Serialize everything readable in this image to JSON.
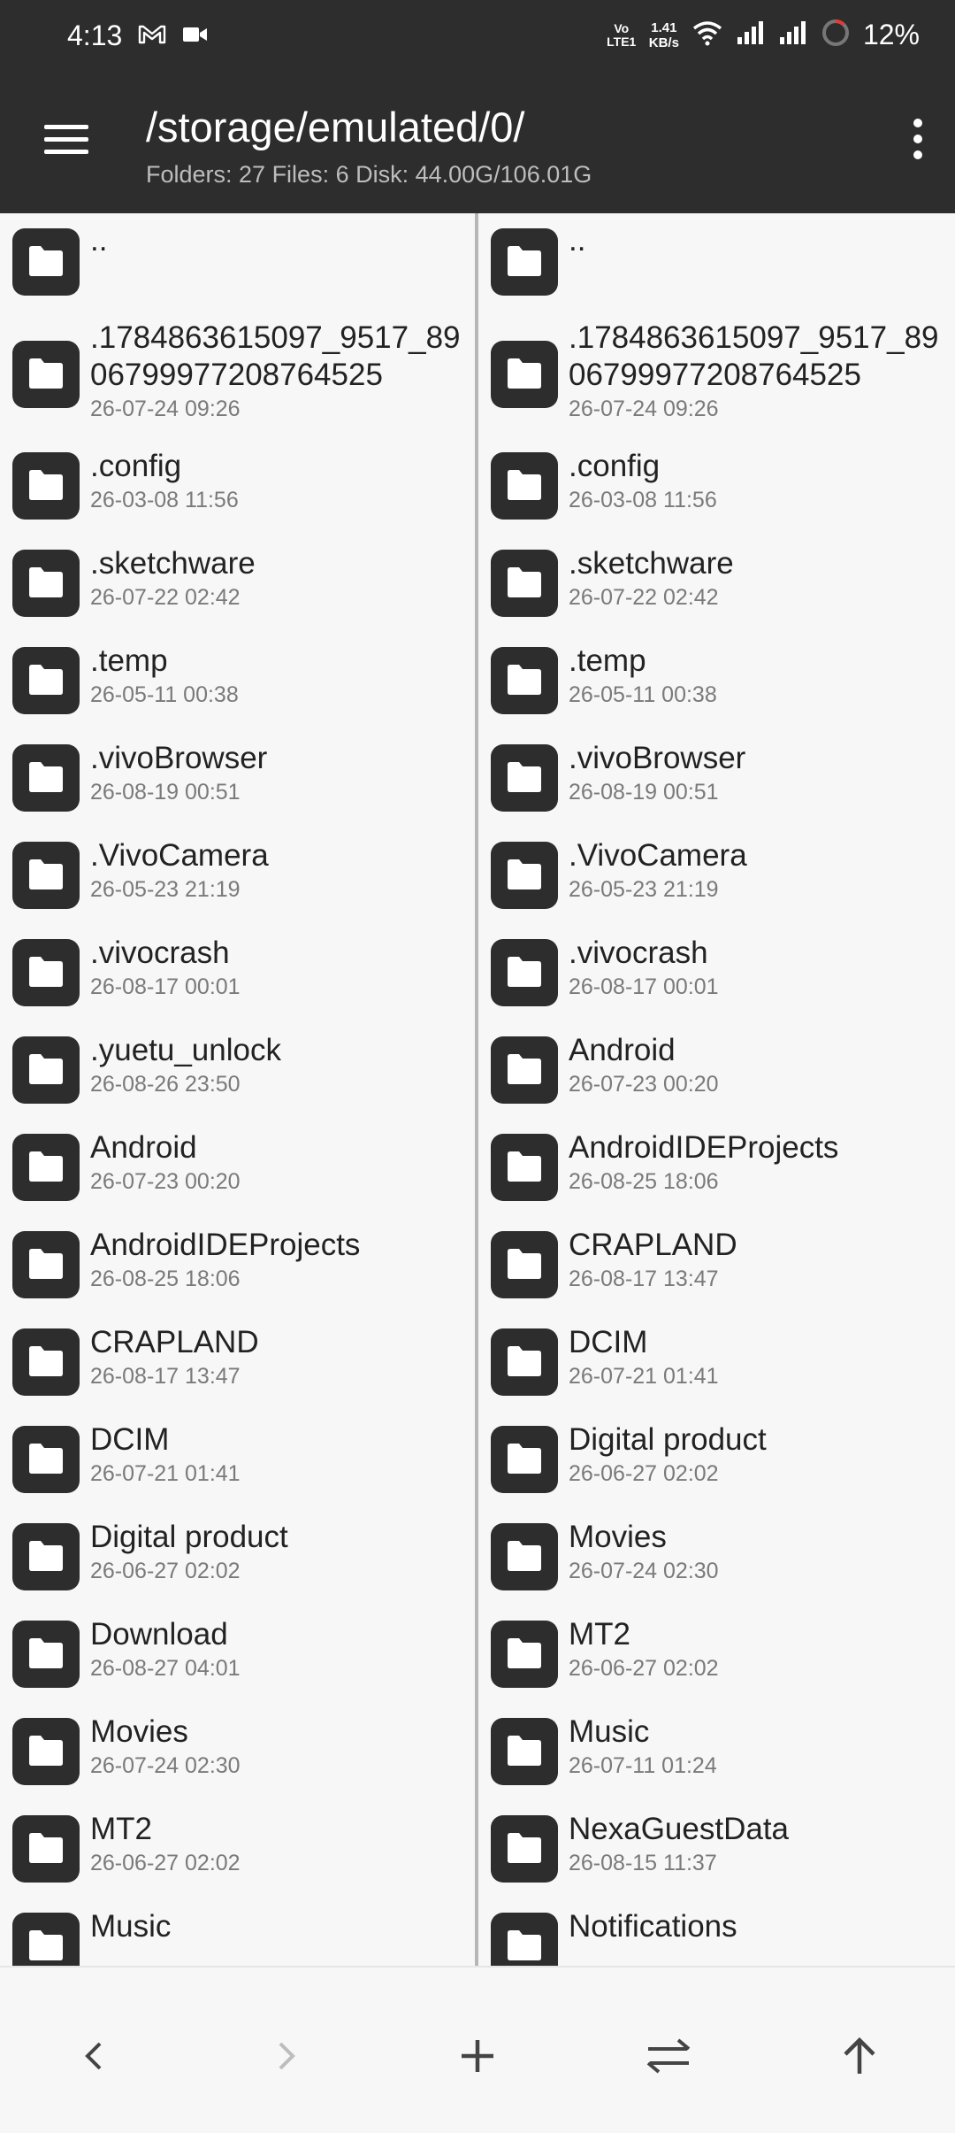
{
  "status_bar": {
    "time": "4:13",
    "volte": "Vo LTE1",
    "speed_value": "1.41",
    "speed_unit": "KB/s",
    "battery": "12%"
  },
  "header": {
    "path": "/storage/emulated/0/",
    "summary": "Folders: 27  Files: 6  Disk: 44.00G/106.01G"
  },
  "left_pane": {
    "items": [
      {
        "name": "..",
        "date": ""
      },
      {
        "name": ".1784863615097_9517_8906799977208764525",
        "date": "26-07-24 09:26"
      },
      {
        "name": ".config",
        "date": "26-03-08 11:56"
      },
      {
        "name": ".sketchware",
        "date": "26-07-22 02:42"
      },
      {
        "name": ".temp",
        "date": "26-05-11 00:38"
      },
      {
        "name": ".vivoBrowser",
        "date": "26-08-19 00:51"
      },
      {
        "name": ".VivoCamera",
        "date": "26-05-23 21:19"
      },
      {
        "name": ".vivocrash",
        "date": "26-08-17 00:01"
      },
      {
        "name": ".yuetu_unlock",
        "date": "26-08-26 23:50"
      },
      {
        "name": "Android",
        "date": "26-07-23 00:20"
      },
      {
        "name": "AndroidIDEProjects",
        "date": "26-08-25 18:06"
      },
      {
        "name": "CRAPLAND",
        "date": "26-08-17 13:47"
      },
      {
        "name": "DCIM",
        "date": "26-07-21 01:41"
      },
      {
        "name": "Digital product",
        "date": "26-06-27 02:02"
      },
      {
        "name": "Download",
        "date": "26-08-27 04:01"
      },
      {
        "name": "Movies",
        "date": "26-07-24 02:30"
      },
      {
        "name": "MT2",
        "date": "26-06-27 02:02"
      },
      {
        "name": "Music",
        "date": ""
      }
    ]
  },
  "right_pane": {
    "items": [
      {
        "name": "..",
        "date": ""
      },
      {
        "name": ".1784863615097_9517_8906799977208764525",
        "date": "26-07-24 09:26"
      },
      {
        "name": ".config",
        "date": "26-03-08 11:56"
      },
      {
        "name": ".sketchware",
        "date": "26-07-22 02:42"
      },
      {
        "name": ".temp",
        "date": "26-05-11 00:38"
      },
      {
        "name": ".vivoBrowser",
        "date": "26-08-19 00:51"
      },
      {
        "name": ".VivoCamera",
        "date": "26-05-23 21:19"
      },
      {
        "name": ".vivocrash",
        "date": "26-08-17 00:01"
      },
      {
        "name": "Android",
        "date": "26-07-23 00:20"
      },
      {
        "name": "AndroidIDEProjects",
        "date": "26-08-25 18:06"
      },
      {
        "name": "CRAPLAND",
        "date": "26-08-17 13:47"
      },
      {
        "name": "DCIM",
        "date": "26-07-21 01:41"
      },
      {
        "name": "Digital product",
        "date": "26-06-27 02:02"
      },
      {
        "name": "Movies",
        "date": "26-07-24 02:30"
      },
      {
        "name": "MT2",
        "date": "26-06-27 02:02"
      },
      {
        "name": "Music",
        "date": "26-07-11 01:24"
      },
      {
        "name": "NexaGuestData",
        "date": "26-08-15 11:37"
      },
      {
        "name": "Notifications",
        "date": ""
      }
    ]
  },
  "bottom_bar": {
    "buttons": [
      "back-icon",
      "forward-icon",
      "plus-icon",
      "swap-icon",
      "up-arrow-icon"
    ]
  },
  "colors": {
    "bar_background": "#2d2d2d",
    "pane_background": "#f7f7f7",
    "folder_icon": "#2d2d2d"
  }
}
